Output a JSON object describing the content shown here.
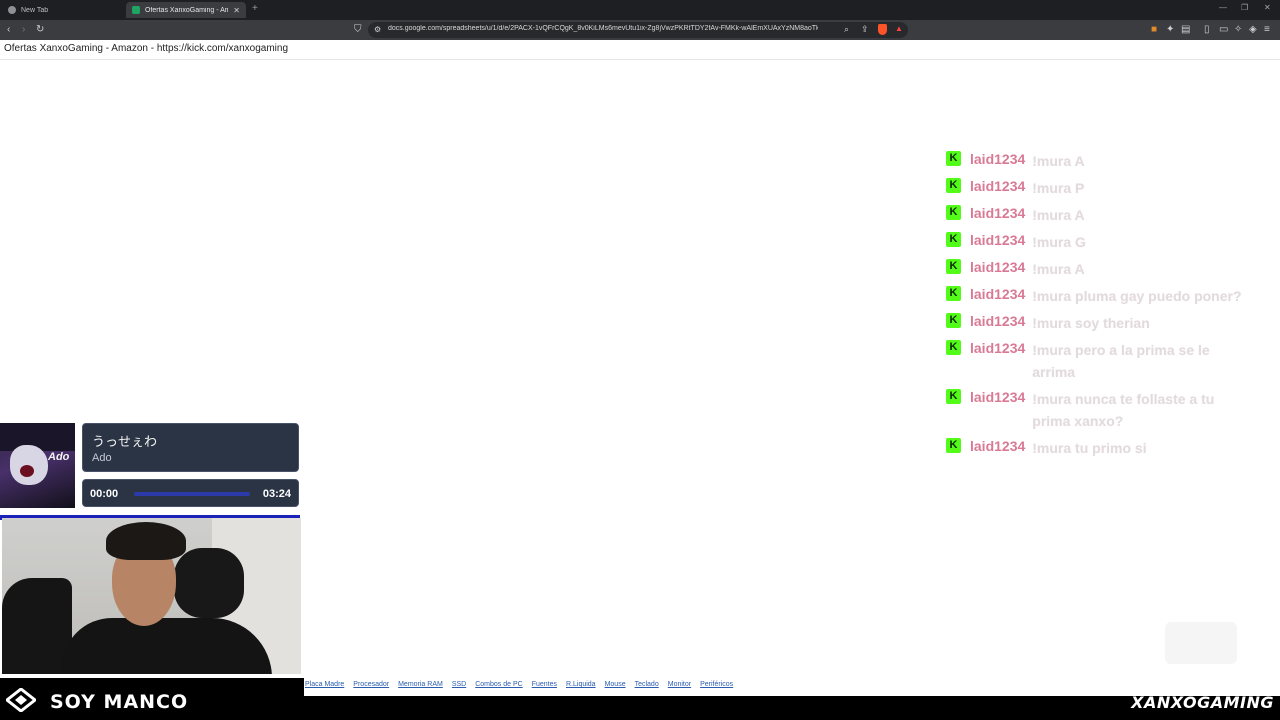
{
  "browser": {
    "tabs": [
      {
        "title": "New Tab",
        "active": false
      },
      {
        "title": "Ofertas XanxoGaming - Amazon",
        "active": true
      }
    ],
    "new_tab_glyph": "+",
    "url": "docs.google.com/spreadsheets/u/1/d/e/2PACX-1vQFrCQgK_8v0KiLMs6mevUtu1ix-Zg8jVwzPKRtTDY2fAv-FMKk-wAlEmXUAxYzNM8aoTkXJwWd...",
    "icons": [
      "back-icon",
      "forward-icon",
      "reload-icon",
      "bookmark-icon",
      "site-settings-icon",
      "zoom-icon",
      "share-icon",
      "brave-shield-icon",
      "alert-icon",
      "extensions-icon",
      "sidebar-icon",
      "wallet-icon",
      "menu-icon"
    ]
  },
  "page": {
    "title": "Ofertas XanxoGaming - Amazon - https://kick.com/xanxogaming"
  },
  "chat": {
    "badge_letter": "K",
    "colors": {
      "username": "#d97a95",
      "badge": "#53fc18"
    },
    "messages": [
      {
        "user": "laid1234",
        "text": "!mura A"
      },
      {
        "user": "laid1234",
        "text": "!mura P"
      },
      {
        "user": "laid1234",
        "text": "!mura A"
      },
      {
        "user": "laid1234",
        "text": "!mura G"
      },
      {
        "user": "laid1234",
        "text": "!mura A"
      },
      {
        "user": "laid1234",
        "text": "!mura pluma gay puedo poner?"
      },
      {
        "user": "laid1234",
        "text": "!mura soy therian"
      },
      {
        "user": "laid1234",
        "text": "!mura pero a la prima se le arrima"
      },
      {
        "user": "laid1234",
        "text": "!mura nunca te follaste a tu prima xanxo?"
      },
      {
        "user": "laid1234",
        "text": "!mura tu primo si"
      }
    ]
  },
  "music": {
    "album_text": "Ado",
    "song_title": "うっせぇわ",
    "artist": "Ado",
    "time_start": "00:00",
    "time_end": "03:24",
    "progress": 0.0
  },
  "bookmarks": [
    "Placa Madre",
    "Procesador",
    "Memoria RAM",
    "SSD",
    "Combos de PC",
    "Fuentes",
    "R.Liquida",
    "Mouse",
    "Teclado",
    "Monitor",
    "Periféricos"
  ],
  "overlay": {
    "left_banner": "SOY MANCO",
    "brand": "XANXOGAMING"
  }
}
